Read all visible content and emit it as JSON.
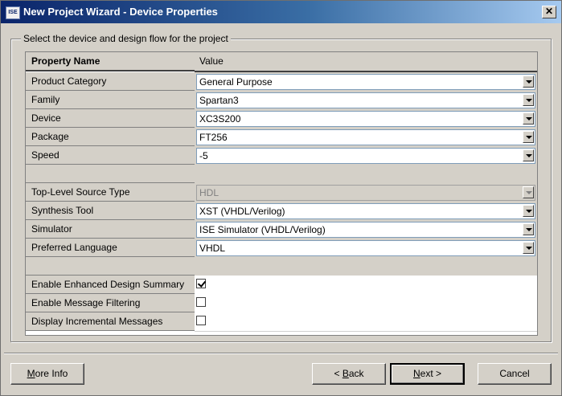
{
  "window": {
    "title": "New Project Wizard - Device Properties",
    "app_icon_label": "ISE",
    "close_label": "✕"
  },
  "group_label": "Select the device and design flow for the project",
  "table": {
    "header": {
      "name": "Property Name",
      "value": "Value"
    },
    "rows": [
      {
        "name": "Product Category",
        "value": "General Purpose",
        "type": "combo"
      },
      {
        "name": "Family",
        "value": "Spartan3",
        "type": "combo"
      },
      {
        "name": "Device",
        "value": "XC3S200",
        "type": "combo"
      },
      {
        "name": "Package",
        "value": "FT256",
        "type": "combo"
      },
      {
        "name": "Speed",
        "value": "-5",
        "type": "combo"
      },
      {
        "name": "",
        "value": "",
        "type": "blank"
      },
      {
        "name": "Top-Level Source Type",
        "value": "HDL",
        "type": "combo-disabled"
      },
      {
        "name": "Synthesis Tool",
        "value": "XST (VHDL/Verilog)",
        "type": "combo"
      },
      {
        "name": "Simulator",
        "value": "ISE Simulator (VHDL/Verilog)",
        "type": "combo"
      },
      {
        "name": "Preferred Language",
        "value": "VHDL",
        "type": "combo"
      },
      {
        "name": "",
        "value": "",
        "type": "blank"
      },
      {
        "name": "Enable Enhanced Design Summary",
        "checked": true,
        "type": "checkbox"
      },
      {
        "name": "Enable Message Filtering",
        "checked": false,
        "type": "checkbox"
      },
      {
        "name": "Display Incremental Messages",
        "checked": false,
        "type": "checkbox"
      }
    ]
  },
  "buttons": {
    "more_info": {
      "pre": "",
      "key": "M",
      "post": "ore Info"
    },
    "back": {
      "pre": "< ",
      "key": "B",
      "post": "ack"
    },
    "next": {
      "pre": "",
      "key": "N",
      "post": "ext >"
    },
    "cancel": {
      "pre": "",
      "key": "",
      "post": "Cancel"
    }
  }
}
